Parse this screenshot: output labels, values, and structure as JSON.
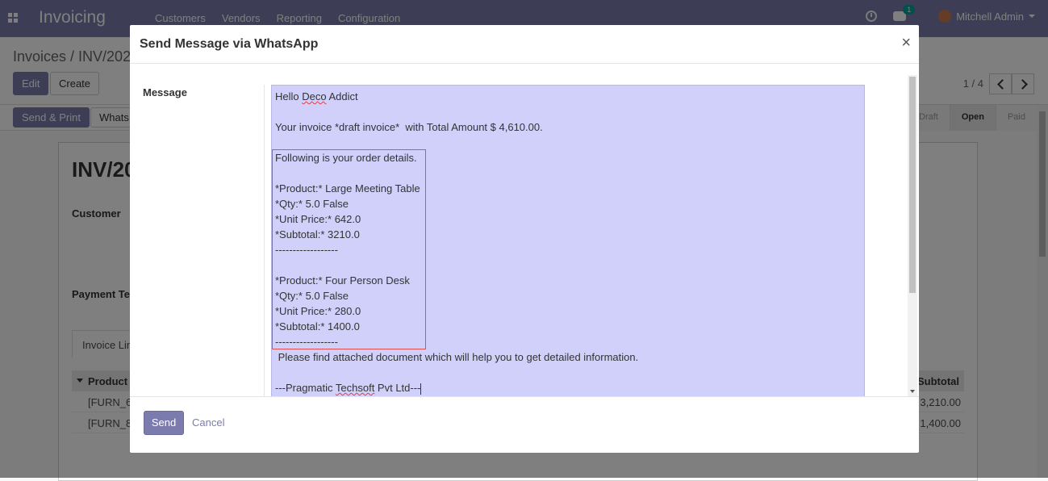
{
  "navbar": {
    "app_title": "Invoicing",
    "menu": [
      "Customers",
      "Vendors",
      "Reporting",
      "Configuration"
    ],
    "chat_badge": "1",
    "user_name": "Mitchell Admin"
  },
  "control": {
    "breadcrumb": "Invoices / INV/202",
    "edit_label": "Edit",
    "create_label": "Create",
    "pager": "1 / 4",
    "send_print_label": "Send & Print",
    "whatsapp_label": "Whats",
    "status_steps": [
      "Draft",
      "Open",
      "Paid"
    ],
    "active_status": "Open"
  },
  "sheet": {
    "title": "INV/20",
    "customer_label": "Customer",
    "payment_terms_label": "Payment Te",
    "tab_label": "Invoice Lin",
    "col_product": "Product",
    "col_subtotal": "Subtotal",
    "rows": [
      {
        "code": "[FURN_6",
        "amount": "3,210.00"
      },
      {
        "code": "[FURN_8",
        "amount": "1,400.00"
      }
    ]
  },
  "modal": {
    "title": "Send Message via WhatsApp",
    "close_glyph": "×",
    "message_label": "Message",
    "message_lines": [
      "Hello Deco Addict",
      "",
      "Your invoice *draft invoice*  with Total Amount $ 4,610.00.",
      "",
      "Following is your order details.",
      "",
      "*Product:* Large Meeting Table",
      "*Qty:* 5.0 False",
      "*Unit Price:* 642.0",
      "*Subtotal:* 3210.0",
      "------------------",
      "",
      "*Product:* Four Person Desk",
      "*Qty:* 5.0 False",
      "*Unit Price:* 280.0",
      "*Subtotal:* 1400.0",
      "------------------",
      " Please find attached document which will help you to get detailed information.",
      "",
      "---Pragmatic Techsoft Pvt Ltd---"
    ],
    "send_label": "Send",
    "cancel_label": "Cancel"
  }
}
